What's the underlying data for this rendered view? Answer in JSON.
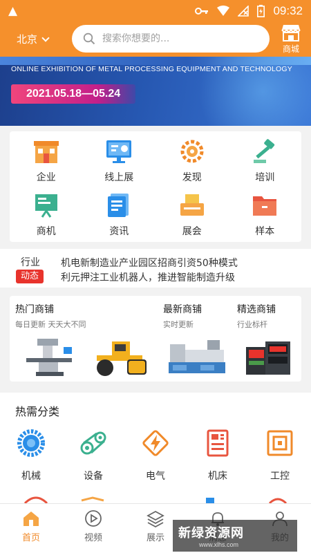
{
  "status_bar": {
    "time": "09:32"
  },
  "header": {
    "city": "北京",
    "search_placeholder": "搜索你想要的...",
    "mall_label": "商城"
  },
  "banner": {
    "subtitle": "ONLINE EXHIBITION OF METAL PROCESSING EQUIPMENT AND TECHNOLOGY",
    "date": "2021.05.18—05.24"
  },
  "categories": [
    {
      "label": "企业",
      "icon": "enterprise-icon"
    },
    {
      "label": "线上展",
      "icon": "online-expo-icon"
    },
    {
      "label": "发现",
      "icon": "discover-icon"
    },
    {
      "label": "培训",
      "icon": "training-icon"
    },
    {
      "label": "商机",
      "icon": "opportunity-icon"
    },
    {
      "label": "资讯",
      "icon": "news-icon"
    },
    {
      "label": "展会",
      "icon": "exhibition-icon"
    },
    {
      "label": "样本",
      "icon": "sample-icon"
    }
  ],
  "news": {
    "tag_top": "行业",
    "tag_bottom": "动态",
    "items": [
      "机电新制造业产业园区招商引资50种模式",
      "利元押注工业机器人，推进智能制造升级"
    ]
  },
  "shops": {
    "hot": {
      "title": "热门商铺",
      "subtitle": "每日更新 天天大不同"
    },
    "newest": {
      "title": "最新商铺",
      "subtitle": "实时更新"
    },
    "featured": {
      "title": "精选商铺",
      "subtitle": "行业标杆"
    }
  },
  "hot_categories": {
    "title": "热需分类",
    "items": [
      {
        "label": "机械",
        "icon": "gear-icon",
        "color": "#2a8ee8"
      },
      {
        "label": "设备",
        "icon": "belt-drive-icon",
        "color": "#3bb08f"
      },
      {
        "label": "电气",
        "icon": "electric-icon",
        "color": "#f08a2a"
      },
      {
        "label": "机床",
        "icon": "machine-tool-icon",
        "color": "#e8553f"
      },
      {
        "label": "工控",
        "icon": "control-panel-icon",
        "color": "#f08a2a"
      }
    ]
  },
  "bottom_nav": [
    {
      "label": "首页",
      "icon": "home-icon",
      "active": true
    },
    {
      "label": "视频",
      "icon": "play-icon",
      "active": false
    },
    {
      "label": "展示",
      "icon": "layers-icon",
      "active": false
    },
    {
      "label": "消息",
      "icon": "bell-icon",
      "active": false
    },
    {
      "label": "我的",
      "icon": "user-icon",
      "active": false
    }
  ],
  "watermark": {
    "text": "新绿资源网",
    "domain": "www.xlhs.com"
  },
  "colors": {
    "accent": "#f5902c",
    "tag_red": "#e8332c",
    "active_tab": "#f08a2a"
  }
}
